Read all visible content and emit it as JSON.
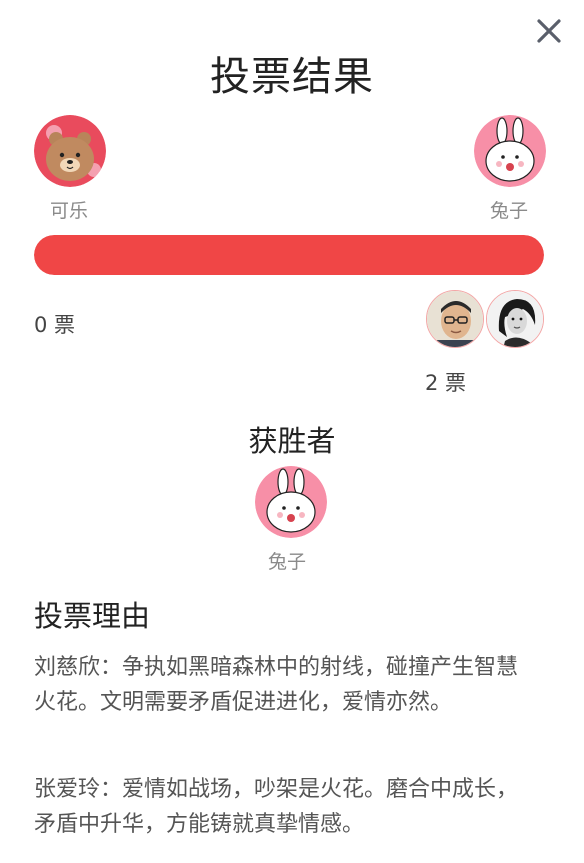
{
  "dialog": {
    "title": "投票结果",
    "close_icon": "close-icon"
  },
  "candidates": {
    "left": {
      "name": "可乐",
      "votes_label": "0 票",
      "votes": 0,
      "avatar": "brown-bear-avatar"
    },
    "right": {
      "name": "兔子",
      "votes_label": "2 票",
      "votes": 2,
      "avatar": "white-bunny-avatar"
    }
  },
  "vote_bar": {
    "right_share": 1.0,
    "fill_color": "#f04646",
    "track_color": "#eeeeee"
  },
  "voters": [
    {
      "avatar": "voter-man-glasses-photo"
    },
    {
      "avatar": "voter-woman-portrait-photo"
    }
  ],
  "winner": {
    "heading": "获胜者",
    "name": "兔子",
    "avatar": "white-bunny-avatar"
  },
  "reasons": {
    "heading": "投票理由",
    "items": [
      {
        "text": "刘慈欣：争执如黑暗森林中的射线，碰撞产生智慧火花。文明需要矛盾促进进化，爱情亦然。"
      },
      {
        "text": "张爱玲：爱情如战场，吵架是火花。磨合中成长，矛盾中升华，方能铸就真挚情感。"
      }
    ]
  },
  "colors": {
    "accent_red": "#f04646",
    "bunny_bg": "#f78fa7",
    "bear_bg": "#e94b5d"
  }
}
